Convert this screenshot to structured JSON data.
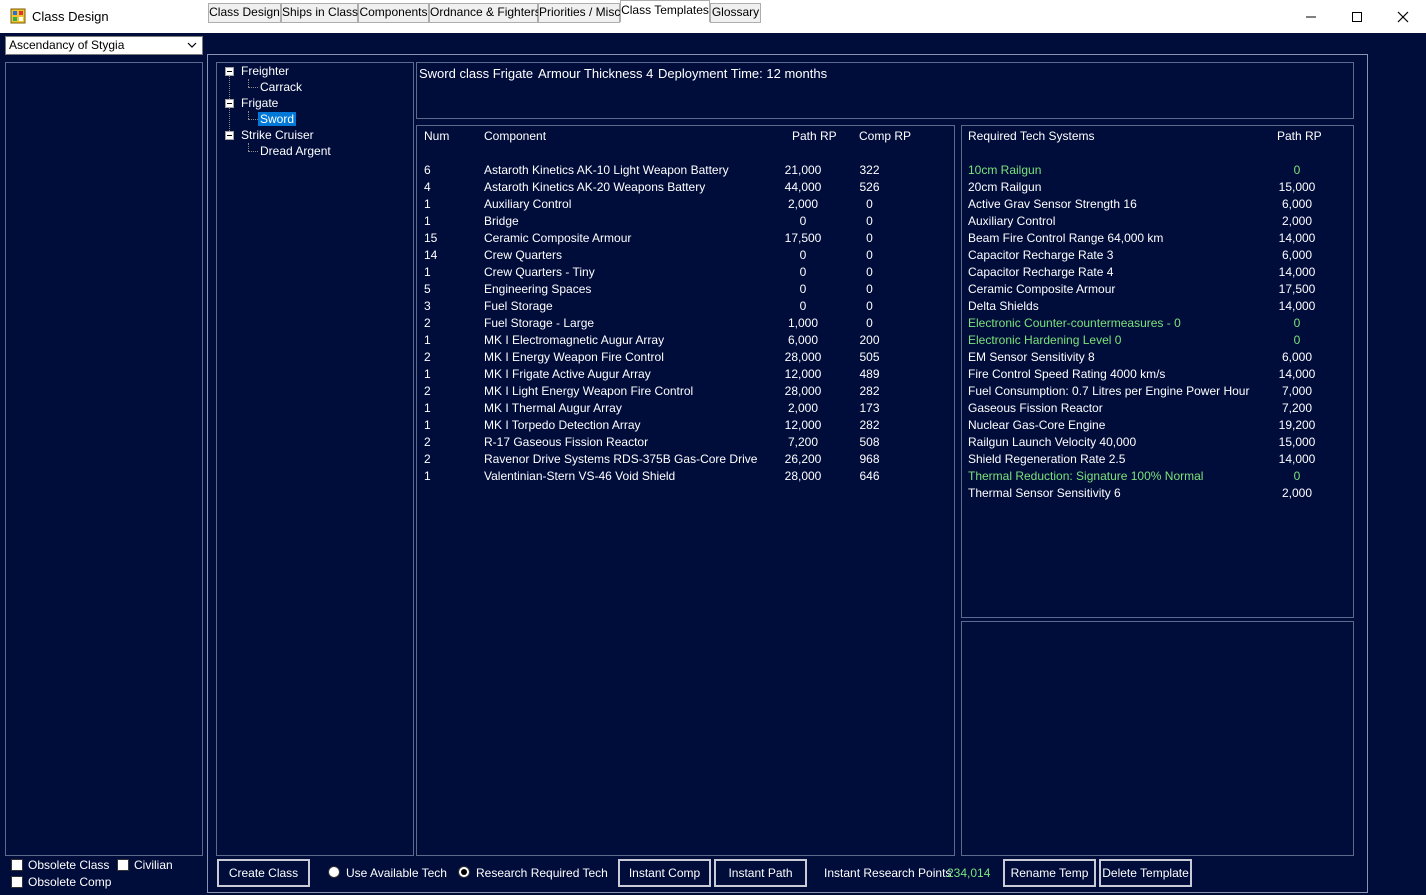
{
  "window": {
    "title": "Class Design"
  },
  "empire": {
    "selected": "Ascendancy of Stygia"
  },
  "tabs": [
    "Class Design",
    "Ships in Class",
    "Components",
    "Ordnance & Fighters",
    "Priorities / Misc",
    "Class Templates",
    "Glossary"
  ],
  "tree": {
    "groups": [
      {
        "label": "Freighter",
        "children": [
          "Carrack"
        ]
      },
      {
        "label": "Frigate",
        "children": [
          "Sword"
        ]
      },
      {
        "label": "Strike Cruiser",
        "children": [
          "Dread Argent"
        ]
      }
    ]
  },
  "summary": {
    "class_name": "Sword class Frigate",
    "armour": "Armour Thickness 4",
    "deployment": "Deployment Time: 12 months"
  },
  "components": {
    "headers": {
      "num": "Num",
      "component": "Component",
      "path_rp": "Path RP",
      "comp_rp": "Comp RP"
    },
    "rows": [
      {
        "num": "6",
        "name": "Astaroth Kinetics AK-10 Light Weapon Battery",
        "path": "21,000",
        "comp": "322"
      },
      {
        "num": "4",
        "name": "Astaroth Kinetics AK-20 Weapons Battery",
        "path": "44,000",
        "comp": "526"
      },
      {
        "num": "1",
        "name": "Auxiliary Control",
        "path": "2,000",
        "comp": "0"
      },
      {
        "num": "1",
        "name": "Bridge",
        "path": "0",
        "comp": "0"
      },
      {
        "num": "15",
        "name": "Ceramic Composite Armour",
        "path": "17,500",
        "comp": "0"
      },
      {
        "num": "14",
        "name": "Crew Quarters",
        "path": "0",
        "comp": "0"
      },
      {
        "num": "1",
        "name": "Crew Quarters - Tiny",
        "path": "0",
        "comp": "0"
      },
      {
        "num": "5",
        "name": "Engineering Spaces",
        "path": "0",
        "comp": "0"
      },
      {
        "num": "3",
        "name": "Fuel Storage",
        "path": "0",
        "comp": "0"
      },
      {
        "num": "2",
        "name": "Fuel Storage - Large",
        "path": "1,000",
        "comp": "0"
      },
      {
        "num": "1",
        "name": "MK I Electromagnetic Augur Array",
        "path": "6,000",
        "comp": "200"
      },
      {
        "num": "2",
        "name": "MK I Energy Weapon Fire Control",
        "path": "28,000",
        "comp": "505"
      },
      {
        "num": "1",
        "name": "MK I Frigate Active Augur Array",
        "path": "12,000",
        "comp": "489"
      },
      {
        "num": "2",
        "name": "MK I Light Energy Weapon Fire Control",
        "path": "28,000",
        "comp": "282"
      },
      {
        "num": "1",
        "name": "MK I Thermal Augur Array",
        "path": "2,000",
        "comp": "173"
      },
      {
        "num": "1",
        "name": "MK I Torpedo Detection Array",
        "path": "12,000",
        "comp": "282"
      },
      {
        "num": "2",
        "name": "R-17 Gaseous Fission Reactor",
        "path": "7,200",
        "comp": "508"
      },
      {
        "num": "2",
        "name": "Ravenor Drive Systems RDS-375B Gas-Core Drive",
        "path": "26,200",
        "comp": "968"
      },
      {
        "num": "1",
        "name": "Valentinian-Stern VS-46 Void Shield",
        "path": "28,000",
        "comp": "646"
      }
    ]
  },
  "tech": {
    "headers": {
      "name": "Required Tech Systems",
      "path_rp": "Path RP"
    },
    "rows": [
      {
        "name": "10cm Railgun",
        "rp": "0",
        "researched": true
      },
      {
        "name": "20cm Railgun",
        "rp": "15,000",
        "researched": false
      },
      {
        "name": "Active Grav Sensor Strength 16",
        "rp": "6,000",
        "researched": false
      },
      {
        "name": "Auxiliary Control",
        "rp": "2,000",
        "researched": false
      },
      {
        "name": "Beam Fire Control Range 64,000 km",
        "rp": "14,000",
        "researched": false
      },
      {
        "name": "Capacitor Recharge Rate 3",
        "rp": "6,000",
        "researched": false
      },
      {
        "name": "Capacitor Recharge Rate 4",
        "rp": "14,000",
        "researched": false
      },
      {
        "name": "Ceramic Composite Armour",
        "rp": "17,500",
        "researched": false
      },
      {
        "name": "Delta Shields",
        "rp": "14,000",
        "researched": false
      },
      {
        "name": "Electronic Counter-countermeasures - 0",
        "rp": "0",
        "researched": true
      },
      {
        "name": "Electronic Hardening Level 0",
        "rp": "0",
        "researched": true
      },
      {
        "name": "EM Sensor Sensitivity 8",
        "rp": "6,000",
        "researched": false
      },
      {
        "name": "Fire Control Speed Rating 4000 km/s",
        "rp": "14,000",
        "researched": false
      },
      {
        "name": "Fuel Consumption: 0.7 Litres per Engine Power Hour",
        "rp": "7,000",
        "researched": false
      },
      {
        "name": "Gaseous Fission Reactor",
        "rp": "7,200",
        "researched": false
      },
      {
        "name": "Nuclear Gas-Core Engine",
        "rp": "19,200",
        "researched": false
      },
      {
        "name": "Railgun Launch Velocity 40,000",
        "rp": "15,000",
        "researched": false
      },
      {
        "name": "Shield Regeneration Rate 2.5",
        "rp": "14,000",
        "researched": false
      },
      {
        "name": "Thermal Reduction: Signature 100% Normal",
        "rp": "0",
        "researched": true
      },
      {
        "name": "Thermal Sensor Sensitivity 6",
        "rp": "2,000",
        "researched": false
      }
    ]
  },
  "filters": {
    "obsolete_class": "Obsolete Class",
    "civilian": "Civilian",
    "obsolete_comp": "Obsolete Comp"
  },
  "bottom": {
    "create_class": "Create Class",
    "use_available_tech": "Use Available Tech",
    "research_required_tech": "Research Required Tech",
    "instant_comp": "Instant Comp",
    "instant_path": "Instant Path",
    "irp_label": "Instant Research Points",
    "irp_value": "234,014",
    "rename_temp": "Rename Temp",
    "delete_template": "Delete Template"
  },
  "colors": {
    "background": "#000c3a",
    "researched_text": "#7be37b",
    "selection": "#0078d7"
  }
}
